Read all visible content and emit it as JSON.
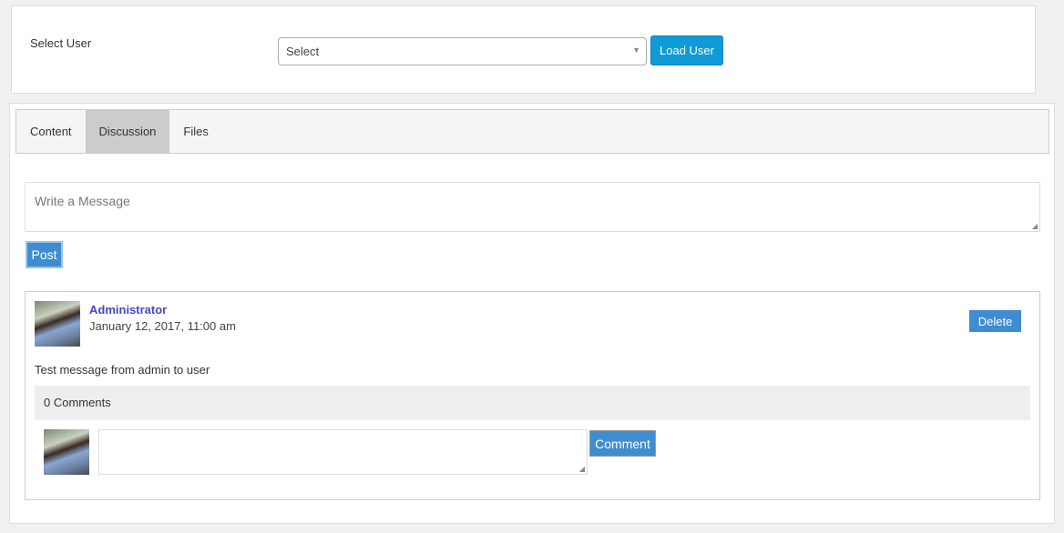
{
  "user_select": {
    "label": "Select User",
    "value": "Select",
    "load_button": "Load User"
  },
  "tabs": [
    {
      "label": "Content"
    },
    {
      "label": "Discussion",
      "active": true
    },
    {
      "label": "Files"
    }
  ],
  "composer": {
    "placeholder": "Write a Message",
    "post_button": "Post"
  },
  "post": {
    "author": "Administrator",
    "date": "January 12, 2017, 11:00 am",
    "delete_button": "Delete",
    "message": "Test message from admin to user",
    "comments_count": "0 Comments",
    "comment_button": "Comment"
  },
  "colors": {
    "primary": "#0f9ad8",
    "button": "#3f8dd0",
    "author": "#4646c8"
  }
}
